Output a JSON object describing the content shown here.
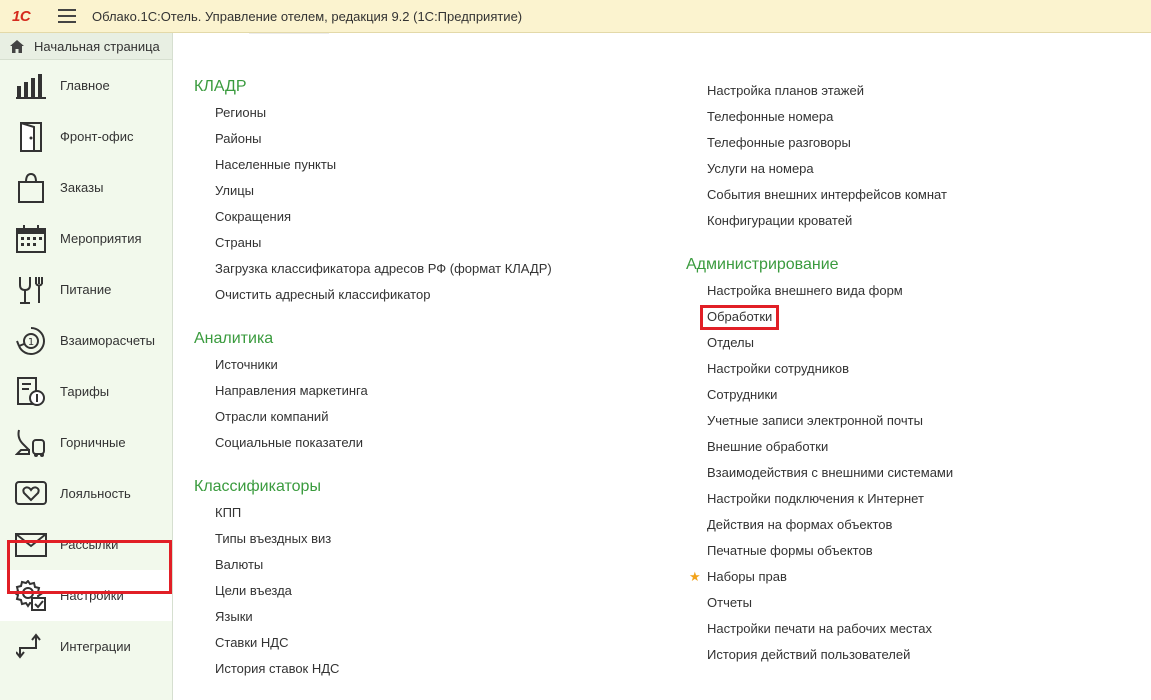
{
  "titlebar": {
    "logo_text": "1С",
    "title": "Облако.1С:Отель. Управление отелем, редакция 9.2  (1С:Предприятие)"
  },
  "sidebar": {
    "home_label": "Начальная страница",
    "items": [
      {
        "label": "Главное",
        "icon": "bar-chart-icon"
      },
      {
        "label": "Фронт-офис",
        "icon": "door-icon"
      },
      {
        "label": "Заказы",
        "icon": "shopping-bag-icon"
      },
      {
        "label": "Мероприятия",
        "icon": "calendar-icon"
      },
      {
        "label": "Питание",
        "icon": "glass-fork-icon"
      },
      {
        "label": "Взаиморасчеты",
        "icon": "coin-cycle-icon"
      },
      {
        "label": "Тарифы",
        "icon": "price-list-icon"
      },
      {
        "label": "Горничные",
        "icon": "vacuum-icon"
      },
      {
        "label": "Лояльность",
        "icon": "heart-card-icon"
      },
      {
        "label": "Рассылки",
        "icon": "envelope-icon"
      },
      {
        "label": "Настройки",
        "icon": "gear-icon"
      },
      {
        "label": "Интеграции",
        "icon": "arrows-icon"
      }
    ],
    "active_index": 10
  },
  "left_column": [
    {
      "title": "КЛАДР",
      "links": [
        "Регионы",
        "Районы",
        "Населенные пункты",
        "Улицы",
        "Сокращения",
        "Страны",
        "Загрузка классификатора адресов РФ (формат КЛАДР)",
        "Очистить адресный классификатор"
      ]
    },
    {
      "title": "Аналитика",
      "links": [
        "Источники",
        "Направления маркетинга",
        "Отрасли компаний",
        "Социальные показатели"
      ]
    },
    {
      "title": "Классификаторы",
      "links": [
        "КПП",
        "Типы въездных виз",
        "Валюты",
        "Цели въезда",
        "Языки",
        "Ставки НДС",
        "История ставок НДС"
      ]
    }
  ],
  "right_top_links": [
    "Настройка планов этажей",
    "Телефонные номера",
    "Телефонные разговоры",
    "Услуги на номера",
    "События внешних интерфейсов комнат",
    "Конфигурации кроватей"
  ],
  "admin": {
    "title": "Администрирование",
    "links": [
      "Настройка внешнего вида форм",
      "Обработки",
      "Отделы",
      "Настройки сотрудников",
      "Сотрудники",
      "Учетные записи электронной почты",
      "Внешние обработки",
      "Взаимодействия с внешними системами",
      "Настройки подключения к Интернет",
      "Действия на формах объектов",
      "Печатные формы объектов",
      "Наборы прав",
      "Отчеты",
      "Настройки печати на рабочих местах",
      "История действий пользователей"
    ],
    "starred_index": 11,
    "highlighted_index": 1
  },
  "colors": {
    "section_title": "#3a9b3e",
    "highlight": "#e11f26",
    "star": "#f2a31b",
    "sidebar_bg": "#f2f9ec",
    "titlebar_bg": "#fbf3cf"
  }
}
